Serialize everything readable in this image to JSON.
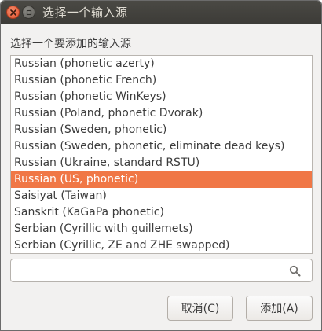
{
  "window": {
    "title": "选择一个输入源",
    "close_icon": "close-icon",
    "minimize_icon": "minimize-icon"
  },
  "prompt": "选择一个要添加的输入源",
  "list": {
    "items": [
      "Russian (phonetic azerty)",
      "Russian (phonetic French)",
      "Russian (phonetic WinKeys)",
      "Russian (Poland, phonetic Dvorak)",
      "Russian (Sweden, phonetic)",
      "Russian (Sweden, phonetic, eliminate dead keys)",
      "Russian (Ukraine, standard RSTU)",
      "Russian (US, phonetic)",
      "Saisiyat (Taiwan)",
      "Sanskrit (KaGaPa phonetic)",
      "Serbian (Cyrillic with guillemets)",
      "Serbian (Cyrillic, ZE and ZHE swapped)"
    ],
    "selected_index": 7
  },
  "search": {
    "value": "",
    "placeholder": "",
    "icon": "search-icon"
  },
  "buttons": {
    "cancel_label": "取消(C)",
    "add_label": "添加(A)"
  },
  "colors": {
    "selection": "#f07746",
    "titlebar": "#3c3b37",
    "close_button": "#e0512e"
  }
}
